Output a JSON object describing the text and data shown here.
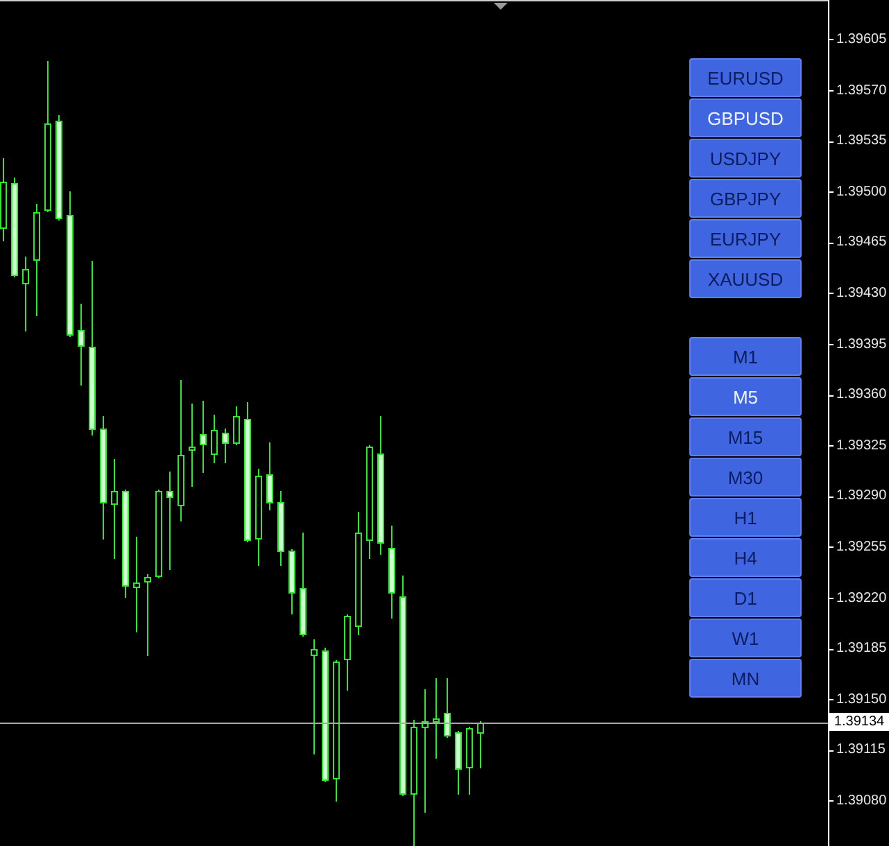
{
  "symbol_buttons": [
    {
      "label": "EURUSD",
      "selected": false
    },
    {
      "label": "GBPUSD",
      "selected": true
    },
    {
      "label": "USDJPY",
      "selected": false
    },
    {
      "label": "GBPJPY",
      "selected": false
    },
    {
      "label": "EURJPY",
      "selected": false
    },
    {
      "label": "XAUUSD",
      "selected": false
    }
  ],
  "timeframe_buttons": [
    {
      "label": "M1",
      "selected": false
    },
    {
      "label": "M5",
      "selected": true
    },
    {
      "label": "M15",
      "selected": false
    },
    {
      "label": "M30",
      "selected": false
    },
    {
      "label": "H1",
      "selected": false
    },
    {
      "label": "H4",
      "selected": false
    },
    {
      "label": "D1",
      "selected": false
    },
    {
      "label": "W1",
      "selected": false
    },
    {
      "label": "MN",
      "selected": false
    }
  ],
  "price_axis": {
    "labels": [
      "1.39605",
      "1.39570",
      "1.39535",
      "1.39500",
      "1.39465",
      "1.39430",
      "1.39395",
      "1.39360",
      "1.39325",
      "1.39290",
      "1.39255",
      "1.39220",
      "1.39185",
      "1.39150",
      "1.39115",
      "1.39080"
    ]
  },
  "current_price": "1.39134"
}
